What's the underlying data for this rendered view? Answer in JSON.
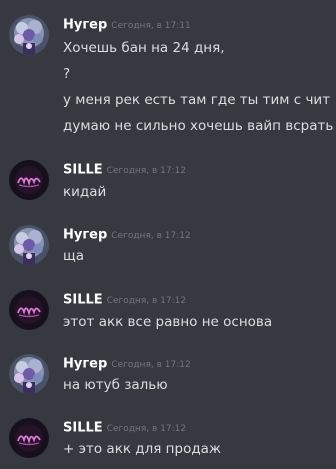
{
  "messages": [
    {
      "author": "Нугер",
      "time": "Сегодня, в 17:11",
      "avatar_icon": "nuger-avatar-icon",
      "lines": [
        "Хочешь бан на 24 дня,",
        "?",
        "у меня рек есть там где ты тим с чит",
        "думаю не сильно хочешь вайп всрать"
      ]
    },
    {
      "author": "SILLE",
      "time": "Сегодня, в 17:12",
      "avatar_icon": "sille-avatar-icon",
      "lines": [
        "кидай"
      ]
    },
    {
      "author": "Нугер",
      "time": "Сегодня, в 17:12",
      "avatar_icon": "nuger-avatar-icon",
      "lines": [
        "ща"
      ]
    },
    {
      "author": "SILLE",
      "time": "Сегодня, в 17:12",
      "avatar_icon": "sille-avatar-icon",
      "lines": [
        "этот акк все равно не основа"
      ]
    },
    {
      "author": "Нугер",
      "time": "Сегодня, в 17:12",
      "avatar_icon": "nuger-avatar-icon",
      "lines": [
        "на ютуб залью"
      ]
    },
    {
      "author": "SILLE",
      "time": "Сегодня, в 17:12",
      "avatar_icon": "sille-avatar-icon",
      "lines": [
        "+ это акк для продаж"
      ]
    }
  ],
  "colors": {
    "background": "#36393f",
    "username": "#ffffff",
    "timestamp": "#72767d",
    "message_text": "#dcddde"
  }
}
